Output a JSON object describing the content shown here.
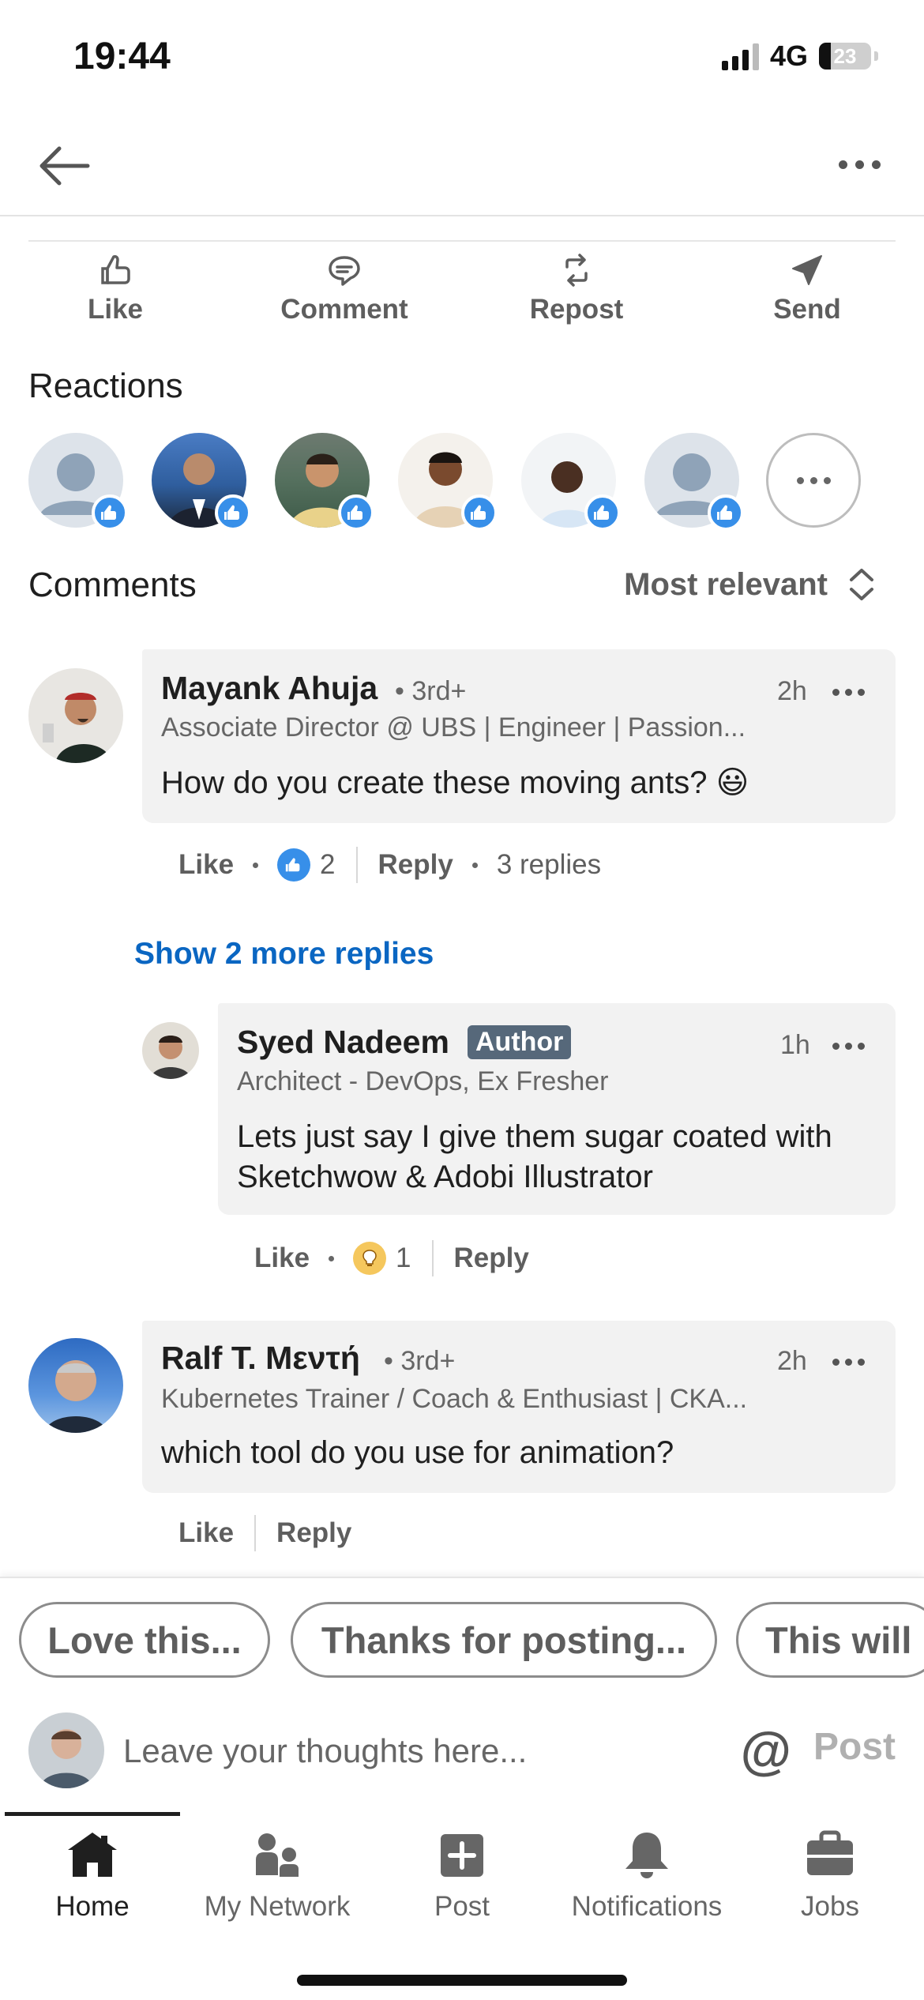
{
  "status_bar": {
    "time": "19:44",
    "network": "4G",
    "battery": "23"
  },
  "actions": [
    {
      "label": "Like",
      "icon": "thumbs-up-icon"
    },
    {
      "label": "Comment",
      "icon": "comment-icon"
    },
    {
      "label": "Repost",
      "icon": "repost-icon"
    },
    {
      "label": "Send",
      "icon": "send-icon"
    }
  ],
  "reactions": {
    "title": "Reactions"
  },
  "comments": {
    "title": "Comments",
    "sort_label": "Most relevant",
    "show_more": "Show 2 more replies",
    "items": [
      {
        "name": "Mayank Ahuja",
        "degree": "• 3rd+",
        "time": "2h",
        "headline": "Associate Director @ UBS | Engineer | Passion...",
        "text": "How do you create these moving ants? 😃",
        "like": "Like",
        "reaction_count": "2",
        "reply": "Reply",
        "replies": "3 replies"
      },
      {
        "name": "Syed Nadeem",
        "badge": "Author",
        "time": "1h",
        "headline": "Architect - DevOps, Ex Fresher",
        "text": "Lets just say I give them sugar coated with Sketchwow & Adobi Illustrator",
        "like": "Like",
        "reaction_count": "1",
        "reply": "Reply"
      },
      {
        "name": "Ralf T. Μεντή",
        "degree": "• 3rd+",
        "time": "2h",
        "headline": "Kubernetes Trainer / Coach & Enthusiast | CKA...",
        "text": "which tool do you use for animation?",
        "like": "Like",
        "reply": "Reply"
      }
    ]
  },
  "quick_replies": [
    "Love this...",
    "Thanks for posting...",
    "This will"
  ],
  "composer": {
    "placeholder": "Leave your thoughts here...",
    "at": "@",
    "post": "Post"
  },
  "tabbar": [
    {
      "label": "Home",
      "icon": "home-icon"
    },
    {
      "label": "My Network",
      "icon": "network-icon"
    },
    {
      "label": "Post",
      "icon": "post-icon"
    },
    {
      "label": "Notifications",
      "icon": "bell-icon"
    },
    {
      "label": "Jobs",
      "icon": "briefcase-icon"
    }
  ],
  "colors": {
    "accent": "#0a66c2",
    "like_blue": "#378fe9",
    "author_badge": "#56687a",
    "bubble": "#f2f2f2"
  }
}
